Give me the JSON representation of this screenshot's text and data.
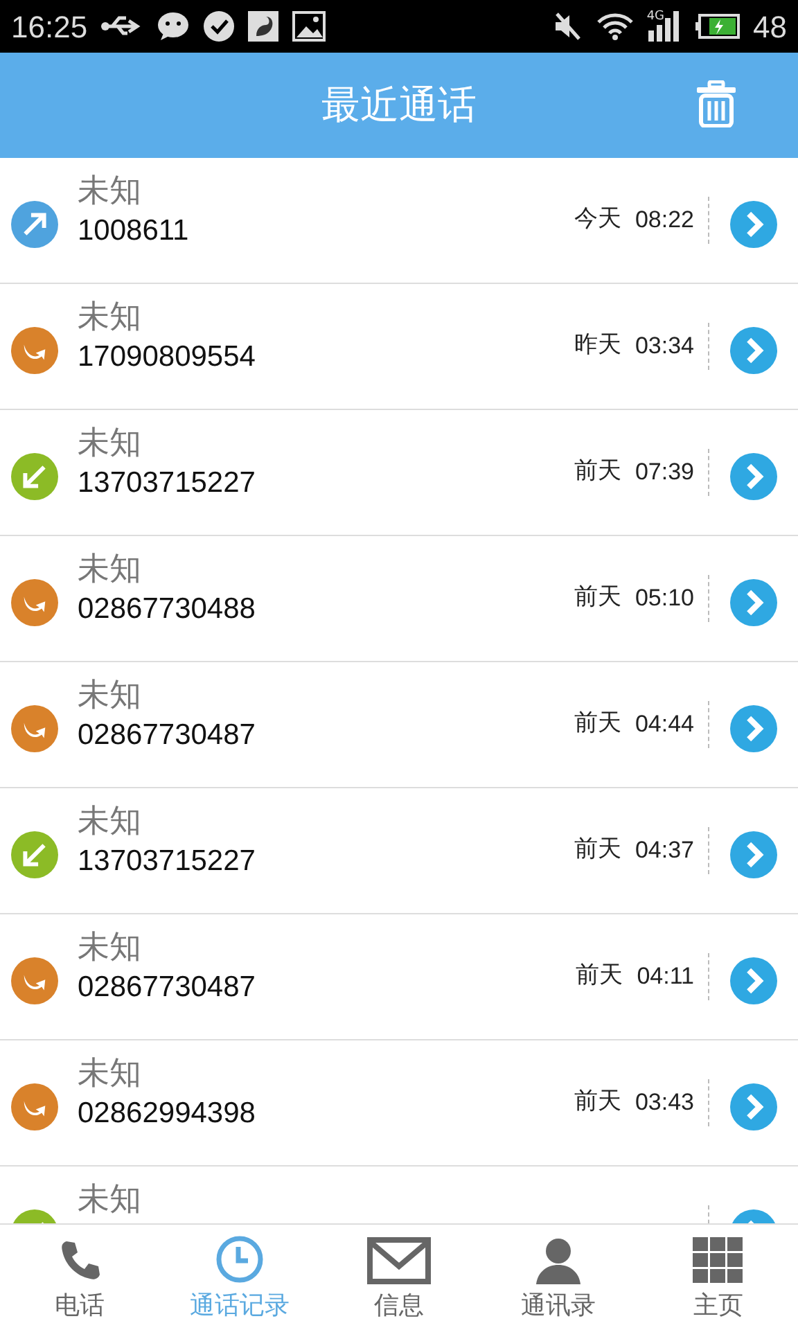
{
  "status_bar": {
    "time": "16:25",
    "network": "4G",
    "battery": "48"
  },
  "header": {
    "title": "最近通话"
  },
  "calls": [
    {
      "kind": "outgoing",
      "name": "未知",
      "number": "1008611",
      "day": "今天",
      "time": "08:22"
    },
    {
      "kind": "missed",
      "name": "未知",
      "number": "17090809554",
      "day": "昨天",
      "time": "03:34"
    },
    {
      "kind": "incoming",
      "name": "未知",
      "number": "13703715227",
      "day": "前天",
      "time": "07:39"
    },
    {
      "kind": "missed",
      "name": "未知",
      "number": "02867730488",
      "day": "前天",
      "time": "05:10"
    },
    {
      "kind": "missed",
      "name": "未知",
      "number": "02867730487",
      "day": "前天",
      "time": "04:44"
    },
    {
      "kind": "incoming",
      "name": "未知",
      "number": "13703715227",
      "day": "前天",
      "time": "04:37"
    },
    {
      "kind": "missed",
      "name": "未知",
      "number": "02867730487",
      "day": "前天",
      "time": "04:11"
    },
    {
      "kind": "missed",
      "name": "未知",
      "number": "02862994398",
      "day": "前天",
      "time": "03:43"
    },
    {
      "kind": "incoming",
      "name": "未知"
    }
  ],
  "tabs": [
    {
      "kind": "phone",
      "label": "电话",
      "selected": false
    },
    {
      "kind": "clock",
      "label": "通话记录",
      "selected": true
    },
    {
      "kind": "mail",
      "label": "信息",
      "selected": false
    },
    {
      "kind": "person",
      "label": "通讯录",
      "selected": false
    },
    {
      "kind": "grid",
      "label": "主页",
      "selected": false
    }
  ]
}
